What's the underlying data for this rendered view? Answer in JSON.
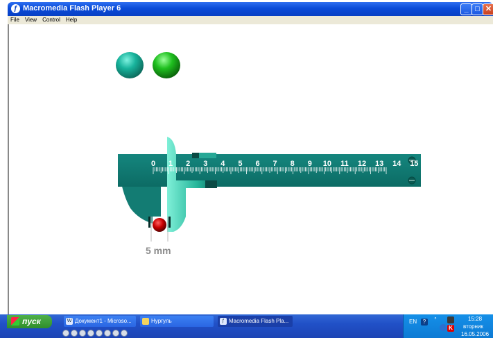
{
  "window": {
    "title": "Macromedia Flash Player 6",
    "controls": {
      "minimize": "_",
      "maximize": "□",
      "close": "✕"
    },
    "menu": [
      "File",
      "View",
      "Control",
      "Help"
    ]
  },
  "caliper": {
    "scale_labels": [
      "0",
      "1",
      "2",
      "3",
      "4",
      "5",
      "6",
      "7",
      "8",
      "9",
      "10",
      "11",
      "12",
      "13",
      "14",
      "15"
    ],
    "reading_text": "5 mm",
    "body_color": "#0f7a74",
    "ball_color": "#c80000"
  },
  "spheres": [
    {
      "name": "teal-sphere",
      "color": "#18b39c"
    },
    {
      "name": "green-sphere",
      "color": "#1fbf1f"
    }
  ],
  "taskbar": {
    "start_label": "пуск",
    "tasks": [
      {
        "label": "Документ1 - Microso...",
        "icon": "word-icon"
      },
      {
        "label": "Нургуль",
        "icon": "folder-icon"
      },
      {
        "label": "Macromedia Flash Pla...",
        "icon": "flash-icon"
      }
    ],
    "tray": {
      "language": "EN",
      "time": "15:28",
      "weekday": "вторник",
      "date": "16.05.2006"
    }
  }
}
